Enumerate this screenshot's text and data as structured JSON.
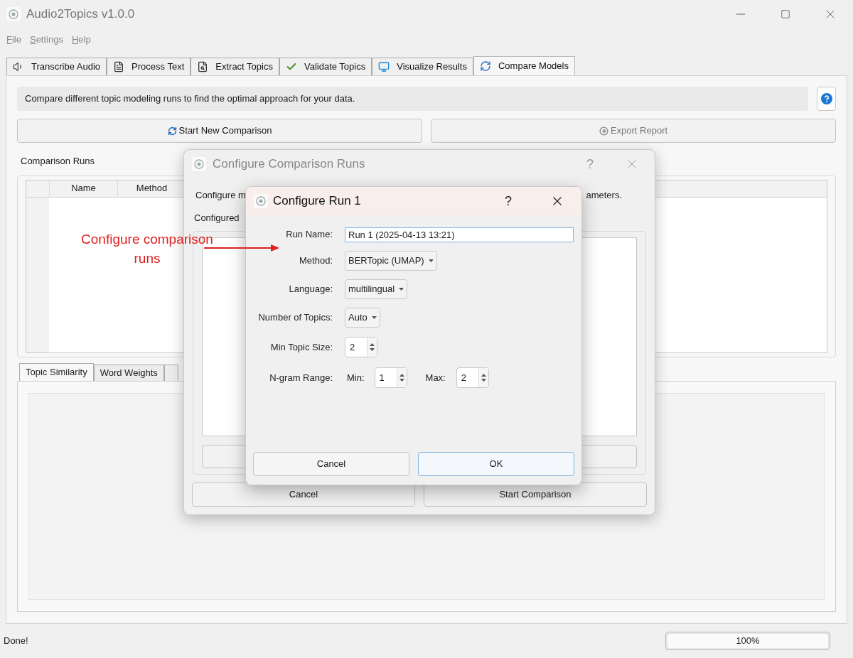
{
  "window": {
    "title": "Audio2Topics v1.0.0"
  },
  "menu": [
    "File",
    "Settings",
    "Help"
  ],
  "tabs": [
    {
      "label": "Transcribe Audio",
      "selected": false
    },
    {
      "label": "Process Text",
      "selected": false
    },
    {
      "label": "Extract Topics",
      "selected": false
    },
    {
      "label": "Validate Topics",
      "selected": false
    },
    {
      "label": "Visualize Results",
      "selected": false
    },
    {
      "label": "Compare Models",
      "selected": true
    }
  ],
  "description": "Compare different topic modeling runs to find the optimal approach for your data.",
  "actions": [
    {
      "label": "Start New Comparison",
      "disabled": false
    },
    {
      "label": "Export Report",
      "disabled": true
    }
  ],
  "runs_section": {
    "title": "Comparison Runs",
    "columns": [
      "Name",
      "Method"
    ]
  },
  "result_tabs": [
    {
      "label": "Topic Similarity",
      "selected": true
    },
    {
      "label": "Word Weights",
      "selected": false
    }
  ],
  "status_bar": {
    "message": "Done!",
    "progress": {
      "level": 1,
      "reading": "100%"
    }
  },
  "outer_dialog": {
    "title": "Configure Comparison Runs",
    "help_glyph": "?",
    "intro_start": "Configure m",
    "intro_end": "ameters.",
    "list_label": "Configured",
    "buttons": [
      "Cancel",
      "Start Comparison"
    ]
  },
  "run_dialog": {
    "title": "Configure Run 1",
    "help_glyph": "?",
    "fields": [
      {
        "kind": "text",
        "label": "Run Name:",
        "value": "Run 1 (2025-04-13 13:21)"
      },
      {
        "kind": "combo",
        "label": "Method:",
        "value": "BERTopic (UMAP)"
      },
      {
        "kind": "combo",
        "label": "Language:",
        "value": "multilingual"
      },
      {
        "kind": "combo",
        "label": "Number of Topics:",
        "value": "Auto"
      },
      {
        "kind": "spin",
        "label": "Min Topic Size:",
        "value": "2"
      },
      {
        "kind": "range",
        "label": "N-gram Range:",
        "min_label": "Min:",
        "min": "1",
        "max_label": "Max:",
        "max": "2"
      }
    ],
    "buttons": [
      {
        "label": "Cancel",
        "default": false
      },
      {
        "label": "OK",
        "default": true
      }
    ]
  },
  "annotation": "Configure comparison runs"
}
